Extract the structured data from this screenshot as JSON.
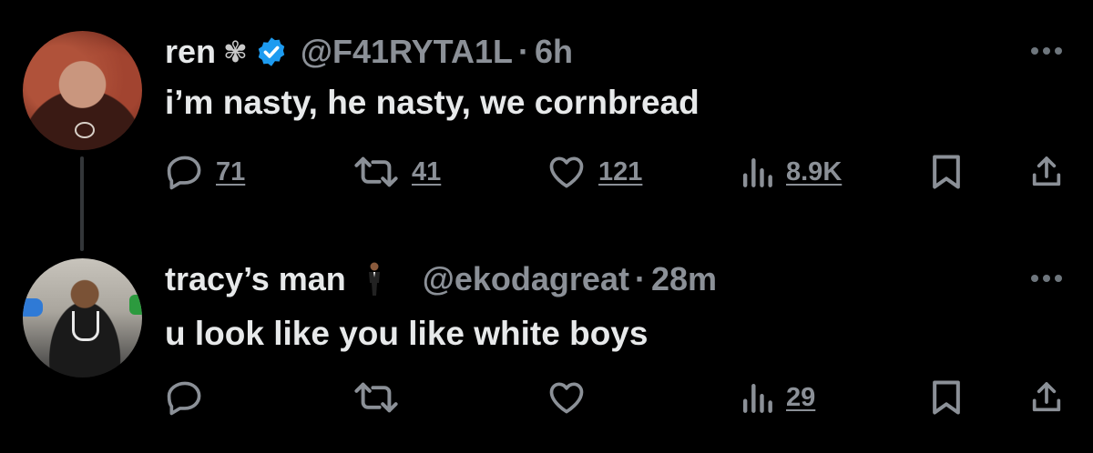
{
  "tweets": [
    {
      "display_name": "ren",
      "name_emoji": "✾",
      "handle": "@F41RYTA1L",
      "separator": "·",
      "time": "6h",
      "text": "i’m nasty, he nasty, we cornbread",
      "counts": {
        "replies": "71",
        "retweets": "41",
        "likes": "121",
        "views": "8.9K"
      }
    },
    {
      "display_name": "tracy’s man",
      "handle": "@ekodagreat",
      "separator": "·",
      "time": "28m",
      "text": "u look like you like white boys",
      "counts": {
        "replies": "",
        "retweets": "",
        "likes": "",
        "views": "29"
      }
    }
  ],
  "colors": {
    "background": "#000000",
    "text": "#e7e9ea",
    "muted": "#8b9097",
    "verified": "#1d9bf0"
  },
  "icons": [
    "reply-icon",
    "retweet-icon",
    "like-icon",
    "views-icon",
    "bookmark-icon",
    "share-icon",
    "more-icon",
    "verified-badge-icon"
  ]
}
